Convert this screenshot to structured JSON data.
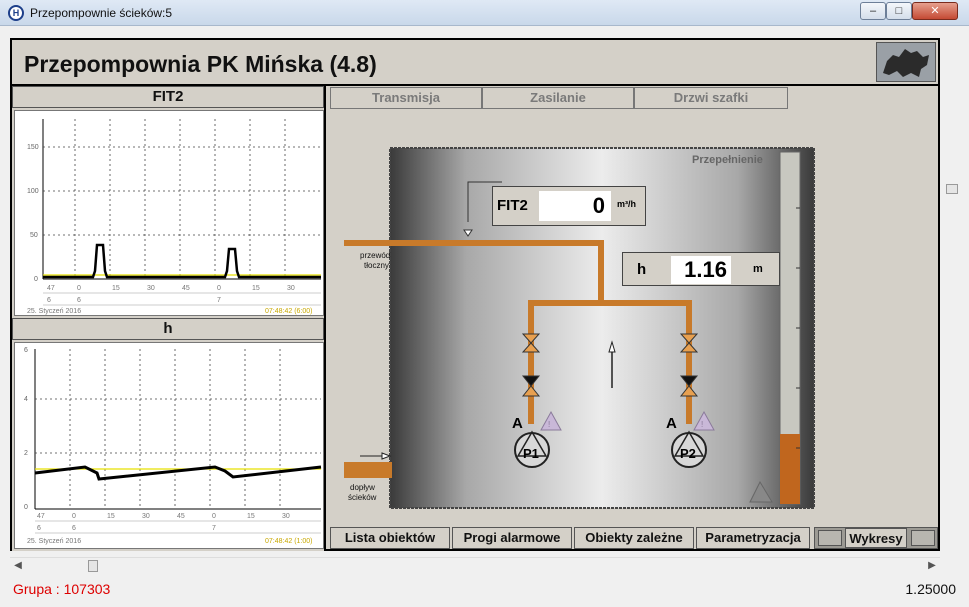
{
  "window": {
    "title": "Przepompownie ścieków:5",
    "icon": "H",
    "min_glyph": "–",
    "max_glyph": "□",
    "close_glyph": "✕"
  },
  "header": {
    "title": "Przepompownia PK Mińska (4.8)"
  },
  "charts": {
    "fit2": {
      "title": "FIT2",
      "y_ticks": [
        "150",
        "100",
        "50",
        "0"
      ],
      "x_ticks_row1": [
        "47",
        "0",
        "15",
        "30",
        "45",
        "0",
        "15",
        "30"
      ],
      "x_ticks_row2": [
        "6",
        "6",
        "7"
      ],
      "date_label": "25. Styczeń 2016",
      "time_label": "07:48:42 (6:00)"
    },
    "h": {
      "title": "h",
      "y_ticks": [
        "6",
        "4",
        "2",
        "0"
      ],
      "x_ticks_row1": [
        "47",
        "0",
        "15",
        "30",
        "45",
        "0",
        "15",
        "30"
      ],
      "x_ticks_row2": [
        "6",
        "6",
        "7"
      ],
      "date_label": "25. Styczeń 2016",
      "time_label": "07:48:42 (1:00)"
    }
  },
  "tabs": [
    {
      "label": "Transmisja"
    },
    {
      "label": "Zasilanie"
    },
    {
      "label": "Drzwi szafki"
    }
  ],
  "scene": {
    "overflow_label": "Przepełnienie",
    "fit2_label": "FIT2",
    "fit2_value": "0",
    "fit2_unit": "m³/h",
    "h_label": "h",
    "h_value": "1.16",
    "h_unit": "m",
    "pressure_label_line1": "przewód",
    "pressure_label_line2": "tłoczny",
    "inflow_label_line1": "dopływ",
    "inflow_label_line2": "ścieków",
    "pump1_label": "P1",
    "pump2_label": "P2",
    "pump1_mode": "A",
    "pump2_mode": "A",
    "pipe_color": "#c87a2a"
  },
  "bottom_buttons": [
    {
      "label": "Lista obiektów"
    },
    {
      "label": "Progi alarmowe"
    },
    {
      "label": "Obiekty zależne"
    },
    {
      "label": "Parametryzacja"
    },
    {
      "label": "Wykresy"
    }
  ],
  "status": {
    "group": "Grupa : 107303",
    "version": "1.25000"
  }
}
